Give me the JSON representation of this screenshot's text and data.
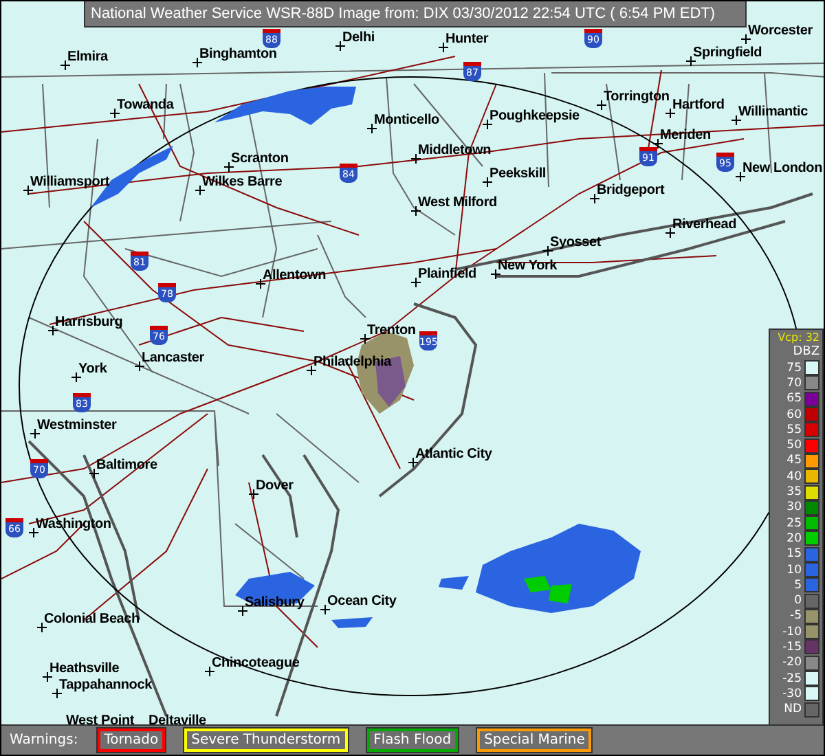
{
  "title": "National Weather Service WSR-88D Image from: DIX 03/30/2012 22:54 UTC ( 6:54 PM EDT)",
  "cities": [
    {
      "name": "Delhi"
    },
    {
      "name": "Hunter"
    },
    {
      "name": "Worcester"
    },
    {
      "name": "Elmira"
    },
    {
      "name": "Binghamton"
    },
    {
      "name": "Springfield"
    },
    {
      "name": "Torrington"
    },
    {
      "name": "Hartford"
    },
    {
      "name": "Willimantic"
    },
    {
      "name": "Towanda"
    },
    {
      "name": "Monticello"
    },
    {
      "name": "Poughkeepsie"
    },
    {
      "name": "Meriden"
    },
    {
      "name": "Middletown"
    },
    {
      "name": "Scranton"
    },
    {
      "name": "Peekskill"
    },
    {
      "name": "New London"
    },
    {
      "name": "Williamsport"
    },
    {
      "name": "Wilkes Barre"
    },
    {
      "name": "Bridgeport"
    },
    {
      "name": "West Milford"
    },
    {
      "name": "Riverhead"
    },
    {
      "name": "Syosset"
    },
    {
      "name": "New York"
    },
    {
      "name": "Plainfield"
    },
    {
      "name": "Allentown"
    },
    {
      "name": "Harrisburg"
    },
    {
      "name": "Trenton"
    },
    {
      "name": "York"
    },
    {
      "name": "Lancaster"
    },
    {
      "name": "Philadelphia"
    },
    {
      "name": "Westminster"
    },
    {
      "name": "Atlantic City"
    },
    {
      "name": "Baltimore"
    },
    {
      "name": "Dover"
    },
    {
      "name": "Washington"
    },
    {
      "name": "Salisbury"
    },
    {
      "name": "Ocean City"
    },
    {
      "name": "Colonial Beach"
    },
    {
      "name": "Heathsville"
    },
    {
      "name": "Chincoteague"
    },
    {
      "name": "Tappahannock"
    },
    {
      "name": "West Point"
    },
    {
      "name": "Deltaville"
    }
  ],
  "interstates": [
    "88",
    "90",
    "87",
    "84",
    "91",
    "95",
    "81",
    "78",
    "76",
    "195",
    "83",
    "70",
    "66"
  ],
  "legend": {
    "vcp": "Vcp: 32",
    "unit": "DBZ",
    "levels": [
      {
        "label": "75",
        "color": "#d8f8f8"
      },
      {
        "label": "70",
        "color": "#888888"
      },
      {
        "label": "65",
        "color": "#7a0099"
      },
      {
        "label": "60",
        "color": "#c00000"
      },
      {
        "label": "55",
        "color": "#d80000"
      },
      {
        "label": "50",
        "color": "#ff0000"
      },
      {
        "label": "45",
        "color": "#ff9900"
      },
      {
        "label": "40",
        "color": "#e8b800"
      },
      {
        "label": "35",
        "color": "#dddd00"
      },
      {
        "label": "30",
        "color": "#008800"
      },
      {
        "label": "25",
        "color": "#00bb00"
      },
      {
        "label": "20",
        "color": "#00cc00"
      },
      {
        "label": "15",
        "color": "#2b64e0"
      },
      {
        "label": "10",
        "color": "#2b64e0"
      },
      {
        "label": "5",
        "color": "#2b64e0"
      },
      {
        "label": "0",
        "color": "#666666"
      },
      {
        "label": "-5",
        "color": "#99936a"
      },
      {
        "label": "-10",
        "color": "#99936a"
      },
      {
        "label": "-15",
        "color": "#663366"
      },
      {
        "label": "-20",
        "color": "#888888"
      },
      {
        "label": "-25",
        "color": "#d8f8f8"
      },
      {
        "label": "-30",
        "color": "#d8f8f8"
      },
      {
        "label": "ND",
        "color": "#666666"
      }
    ]
  },
  "warnings": {
    "label": "Warnings:",
    "items": [
      {
        "label": "Tornado",
        "color": "#ff0000"
      },
      {
        "label": "Severe Thunderstorm",
        "color": "#ffff00"
      },
      {
        "label": "Flash Flood",
        "color": "#00aa00"
      },
      {
        "label": "Special Marine",
        "color": "#ff9900"
      }
    ]
  }
}
